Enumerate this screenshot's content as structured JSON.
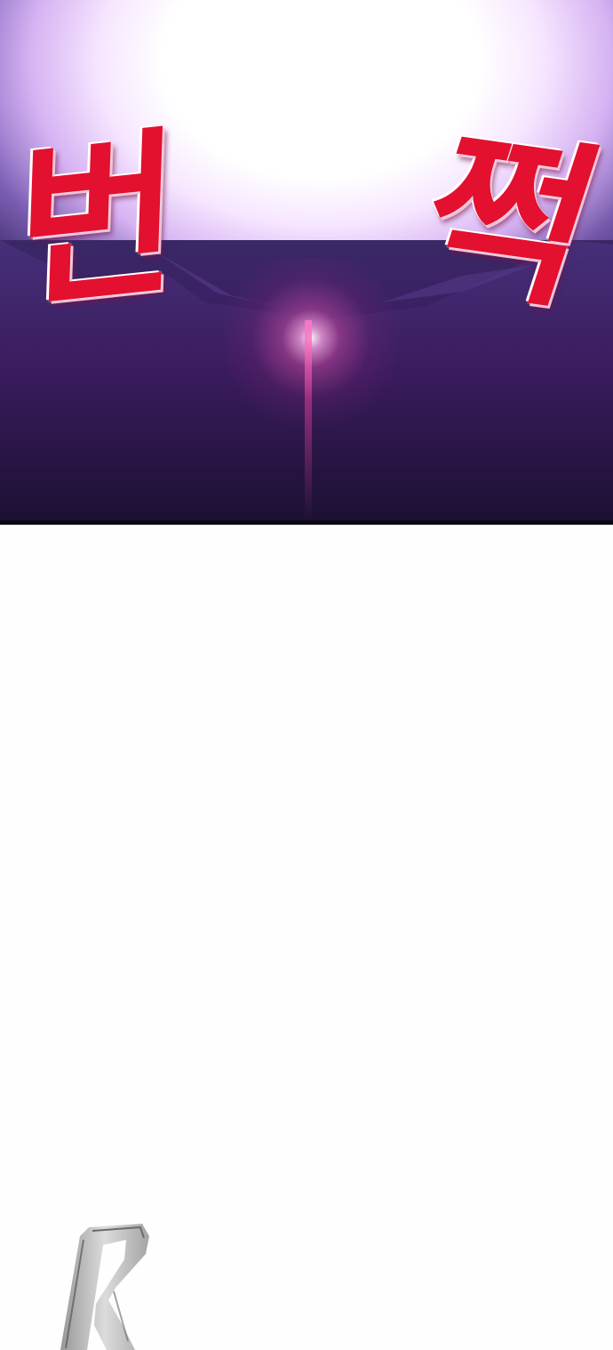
{
  "sfx": {
    "left_char": "번",
    "right_char": "쩍"
  },
  "colors": {
    "sfx_red": "#e3102f",
    "flash_white": "#ffffff",
    "sky_violet": "#6c5aa6",
    "ground_purple": "#3d1a5a",
    "flare_pink": "#ff78c8",
    "page_background": "#fefefe"
  }
}
